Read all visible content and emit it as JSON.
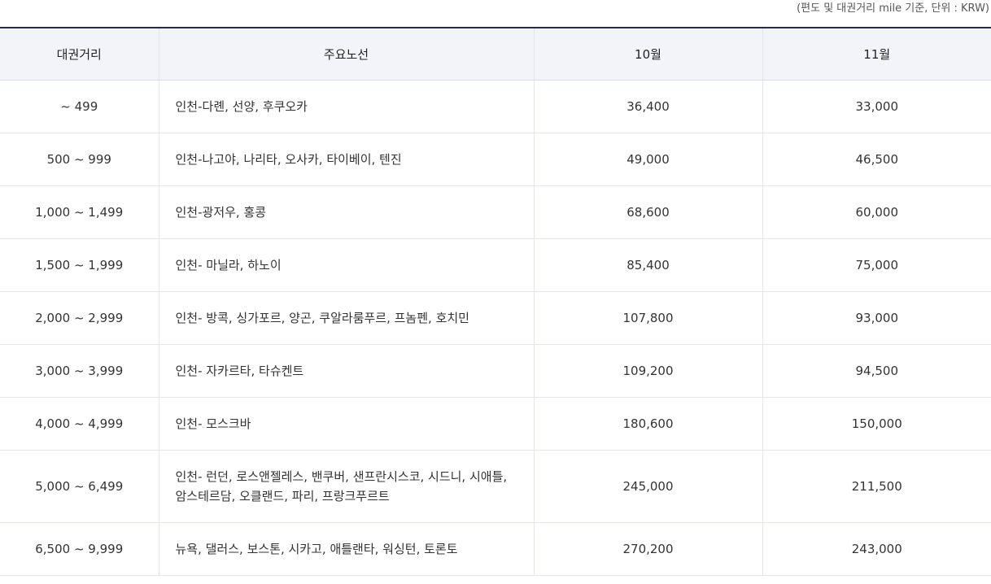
{
  "note": "(편도 및 대권거리 mile 기준, 단위 : KRW)",
  "headers": [
    "대권거리",
    "주요노선",
    "10월",
    "11월"
  ],
  "rows": [
    {
      "distance": "~ 499",
      "routes": "인천-다롄, 선양, 후쿠오카",
      "oct": "36,400",
      "nov": "33,000"
    },
    {
      "distance": "500 ~ 999",
      "routes": "인천-나고야, 나리타, 오사카, 타이베이, 텐진",
      "oct": "49,000",
      "nov": "46,500"
    },
    {
      "distance": "1,000 ~ 1,499",
      "routes": "인천-광저우, 홍콩",
      "oct": "68,600",
      "nov": "60,000"
    },
    {
      "distance": "1,500 ~ 1,999",
      "routes": "인천- 마닐라, 하노이",
      "oct": "85,400",
      "nov": "75,000"
    },
    {
      "distance": "2,000 ~ 2,999",
      "routes": "인천- 방콕, 싱가포르, 양곤, 쿠알라룸푸르, 프놈펜, 호치민",
      "oct": "107,800",
      "nov": "93,000"
    },
    {
      "distance": "3,000 ~ 3,999",
      "routes": "인천- 자카르타, 타슈켄트",
      "oct": "109,200",
      "nov": "94,500"
    },
    {
      "distance": "4,000 ~ 4,999",
      "routes": "인천- 모스크바",
      "oct": "180,600",
      "nov": "150,000"
    },
    {
      "distance": "5,000 ~ 6,499",
      "routes": "인천- 런던, 로스앤젤레스, 밴쿠버, 샌프란시스코, 시드니, 시애틀, 암스테르담, 오클랜드, 파리, 프랑크푸르트",
      "oct": "245,000",
      "nov": "211,500"
    },
    {
      "distance": "6,500 ~ 9,999",
      "routes": "뉴욕, 댈러스, 보스톤, 시카고, 애틀랜타, 워싱턴, 토론토",
      "oct": "270,200",
      "nov": "243,000"
    }
  ]
}
